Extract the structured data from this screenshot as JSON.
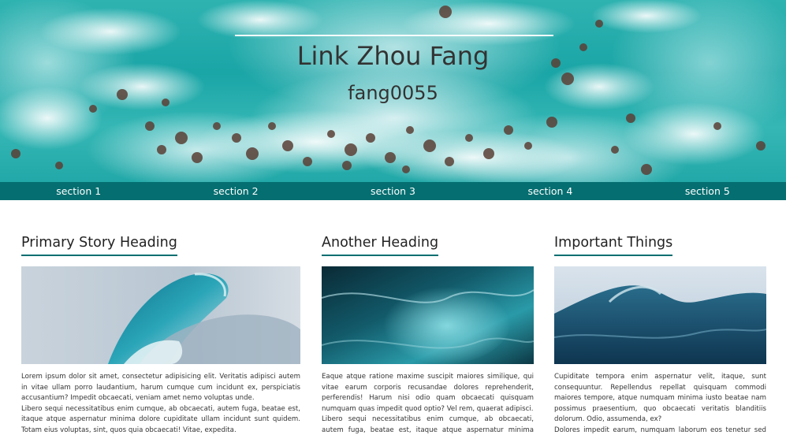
{
  "hero": {
    "name": "Link Zhou Fang",
    "handle": "fang0055"
  },
  "nav": {
    "items": [
      "section 1",
      "section 2",
      "section 3",
      "section 4",
      "section 5"
    ]
  },
  "columns": [
    {
      "heading": "Primary Story Heading",
      "image": "wave-tube-image",
      "paragraphs": [
        "Lorem ipsum dolor sit amet, consectetur adipisicing elit. Veritatis adipisci autem in vitae ullam porro laudantium, harum cumque cum incidunt ex, perspiciatis accusantium? Impedit obcaecati, veniam amet nemo voluptas unde.",
        "Libero sequi necessitatibus enim cumque, ab obcaecati, autem fuga, beatae est, itaque atque aspernatur minima dolore cupiditate ullam incidunt sunt quidem. Totam eius voluptas, sint, quos quia obcaecati! Vitae, expedita."
      ]
    },
    {
      "heading": "Another Heading",
      "image": "wave-closeup-image",
      "paragraphs": [
        "Eaque atque ratione maxime suscipit maiores similique, qui vitae earum corporis recusandae dolores reprehenderit, perferendis! Harum nisi odio quam obcaecati quisquam numquam quas impedit quod optio? Vel rem, quaerat adipisci.",
        "Libero sequi necessitatibus enim cumque, ab obcaecati, autem fuga, beatae est, itaque atque aspernatur minima dolore cupiditate"
      ]
    },
    {
      "heading": "Important Things",
      "image": "ocean-wave-image",
      "paragraphs": [
        "Cupiditate tempora enim aspernatur velit, itaque, sunt consequuntur. Repellendus repellat quisquam commodi maiores tempore, atque numquam minima iusto beatae nam possimus praesentium, quo obcaecati veritatis blanditiis dolorum. Odio, assumenda, ex?",
        "Dolores impedit earum, numquam laborum eos tenetur sed officiis"
      ]
    }
  ],
  "colors": {
    "accent": "#046e70",
    "nav_text": "#ffffff",
    "heading_text": "#222222"
  }
}
